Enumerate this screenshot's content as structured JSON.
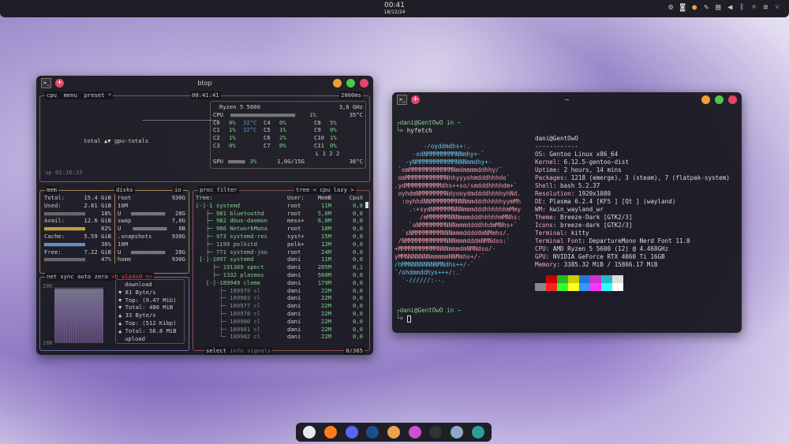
{
  "topbar": {
    "time": "00:41",
    "date": "18/12/24",
    "tray_icons": [
      "network-icon",
      "discord-icon",
      "avatar-icon",
      "color-picker-icon",
      "clipboard-icon",
      "volume-icon",
      "bluetooth-icon",
      "brightness-icon",
      "wifi-icon",
      "chevron-down-icon"
    ]
  },
  "btop": {
    "title": "btop",
    "cpu": {
      "tabs": [
        "cpu",
        "menu",
        "preset *"
      ],
      "clock": "00:41:41",
      "interval": "2000ms",
      "model": "Ryzen 5 5600",
      "freq": "3,6 GHz",
      "total": {
        "label": "CPU",
        "pct": "1%",
        "temp": "35°C"
      },
      "cores": [
        [
          "C0",
          "0%",
          "32°C"
        ],
        [
          "C1",
          "1%",
          "32°C"
        ],
        [
          "C2",
          "1%",
          ""
        ],
        [
          "C3",
          "0%",
          ""
        ],
        [
          "C4",
          "0%",
          ""
        ],
        [
          "C5",
          "1%",
          ""
        ],
        [
          "C6",
          "2%",
          ""
        ],
        [
          "C7",
          "0%",
          ""
        ],
        [
          "C8",
          "5%",
          ""
        ],
        [
          "C9",
          "0%",
          ""
        ],
        [
          "C10",
          "1%",
          ""
        ],
        [
          "C11",
          "0%",
          ""
        ]
      ],
      "load": "L 1 2 2",
      "gpu": {
        "label": "GPU",
        "pct": "3%",
        "mem": "1,0G/15G",
        "temp": "36°C"
      },
      "graph_label": "total ▲▼ gpu-totals",
      "uptime": "up 02:16:15"
    },
    "mem": {
      "header": "mem",
      "rows": [
        [
          "Total:",
          "15.4 GiB",
          ""
        ],
        [
          "Used:",
          "2.81 GiB",
          "18%"
        ],
        [
          "Avail:",
          "12.6 GiB",
          "82%"
        ],
        [
          "Cache:",
          "5.59 GiB",
          "36%"
        ],
        [
          "Free:",
          "7.22 GiB",
          "47%"
        ]
      ]
    },
    "disks": {
      "header": "disks",
      "io": "io",
      "items": [
        [
          "root",
          "930G",
          "10M",
          "U",
          "28G"
        ],
        [
          "swap",
          "7,0G",
          "",
          "U",
          "0B"
        ],
        [
          ".snapshots",
          "930G",
          "10M",
          "U",
          "28G"
        ],
        [
          "home",
          "930G",
          "",
          "",
          ""
        ]
      ]
    },
    "net": {
      "header": "net",
      "tabs": [
        "sync",
        "auto",
        "zero",
        "<b wlp4s0 n>"
      ],
      "scale_top": "20K",
      "scale_bottom": "20K",
      "lines": [
        "download",
        "▼ 81 Byte/s",
        "▼ Top: (9.47 Mib)",
        "▼ Total:  480 MiB",
        "▲ 33 Byte/s",
        "▲ Top: (512 Kibp)",
        "▲ Total: 58.8 MiB",
        "upload"
      ]
    },
    "proc": {
      "header": "proc",
      "filter": "filter",
      "tree": "tree",
      "sort": "< cpu lazy >",
      "columns": [
        "Tree:",
        "User:",
        "MemB",
        "CpuX"
      ],
      "rows": [
        [
          "[-]-1 systemd",
          "root",
          "11M",
          "0,0"
        ],
        [
          "   ├─ 981 bluetoothd",
          "root",
          "5,0M",
          "0,0"
        ],
        [
          "   ├─ 982 dbus-daemon",
          "mess+",
          "6,0M",
          "0,0"
        ],
        [
          "   ├─ 986 NetworkMana",
          "root",
          "10M",
          "0,0"
        ],
        [
          "   ├─ 973 systemd-res",
          "syst+",
          "15M",
          "0,0"
        ],
        [
          "   ├─ 1199 polkitd",
          "polk+",
          "12M",
          "0,0"
        ],
        [
          "   ├─ 771 systemd-jou",
          "root",
          "24M",
          "0,0"
        ],
        [
          " [-]-1097 systemd",
          "dani",
          "11M",
          "0,0"
        ],
        [
          "     ├─ 191389 spect",
          "dani",
          "205M",
          "0,1"
        ],
        [
          "     ├─ 1332 plasmas",
          "dani",
          "560M",
          "0,0"
        ],
        [
          "   [-]-189949 cleme",
          "dani",
          "179M",
          "0,0"
        ],
        [
          "       ├─ 189979 cl",
          "dani",
          "22M",
          "0,0"
        ],
        [
          "       ├─ 189983 cl",
          "dani",
          "22M",
          "0,0"
        ],
        [
          "       ├─ 189977 cl",
          "dani",
          "22M",
          "0,0"
        ],
        [
          "       ├─ 189978 cl",
          "dani",
          "22M",
          "0,0"
        ],
        [
          "       ├─ 189980 cl",
          "dani",
          "22M",
          "0,0"
        ],
        [
          "       ├─ 189981 cl",
          "dani",
          "22M",
          "0,0"
        ],
        [
          "       └─ 189982 cl",
          "dani",
          "22M",
          "0,0"
        ]
      ],
      "footer": [
        "select",
        "info",
        "signals"
      ],
      "count": "0/365"
    }
  },
  "kitty": {
    "title": "~",
    "prompt1": "dani@GentOwO in ~",
    "command": "hyfetch",
    "art": [
      "        -/oyddmdhs+:.",
      "     -odNMMMMMMMMNNmhy+-`",
      "   -yNMMMMMMMMMMMNNNmmdhy+-",
      " `omMMMMMMMMMMMMNmdmmmmddhhy/`",
      " omMMMMMMMMMMMNhhyyyohmdddhhhdo`",
      ".ydMMMMMMMMMMdhs++so/smdddhhhhdm+`",
      " oyhdmNMMMMMMMNdyooydmddddhhhhyhNd.",
      "  :oyhhdNNMMMMMMMNNNmmdddhhhhhyymMh",
      "    .:+sydNMMMMMNNNmmmdddhhhhhhmMmy",
      "       /mMMMMMMNNNmmmdddhhhhhmMNhs:",
      "    `oNMMMMMMMNNNmmmddddhhdmMNhs+`",
      "  `sNMMMMMMMMNNNmmmdddddmNMmhs/.",
      " /NMMMMMMMMMMMNNNmmmdddmNMNdso:`",
      "+MMMMMMMMMMMNNNmmmdmNMNdso/-",
      "yMMNNNNNNNmmmmmNNMmhs+/-`",
      "/hMMNNNNNNNNMNdhs++/-`",
      "`/ohdmmddhys+++/:.`",
      "  `-//////:--."
    ],
    "user": "dani@GentOwO",
    "sep": "------------",
    "info": [
      [
        "OS",
        "Gentoo Linux x86_64"
      ],
      [
        "Kernel",
        "6.12.5-gentoo-dist"
      ],
      [
        "Uptime",
        "2 hours, 14 mins"
      ],
      [
        "Packages",
        "1218 (emerge), 3 (steam), 7 (flatpak-system)"
      ],
      [
        "Shell",
        "bash 5.2.37"
      ],
      [
        "Resolution",
        "1920x1080"
      ],
      [
        "DE",
        "Plasma 6.2.4 [KF5 ] [Qt ] (wayland)"
      ],
      [
        "WM",
        "kwin_wayland_wr"
      ],
      [
        "Theme",
        "Breeze-Dark [GTK2/3]"
      ],
      [
        "Icons",
        "breeze-dark [GTK2/3]"
      ],
      [
        "Terminal",
        "kitty"
      ],
      [
        "Terminal Font",
        "DepartureMono Nerd Font 11.0"
      ],
      [
        "CPU",
        "AMD Ryzen 5 5600 (12) @ 4.468GHz"
      ],
      [
        "GPU",
        "NVIDIA GeForce RTX 4060 Ti 16GB"
      ],
      [
        "Memory",
        "3385.32 MiB / 15866.17 MiB"
      ]
    ],
    "palette_top": [
      "#1e1e26",
      "#cc0000",
      "#22bb22",
      "#cccc00",
      "#2277dd",
      "#cc33cc",
      "#22bbcc",
      "#dddddd"
    ],
    "palette_bottom": [
      "#888888",
      "#ff2222",
      "#33ff33",
      "#ffff22",
      "#3399ff",
      "#ff33ff",
      "#33ffff",
      "#ffffff"
    ],
    "prompt2": "dani@GentOwO in ~"
  },
  "dock": {
    "apps": [
      {
        "name": "dolphin",
        "color": "#e8e8f0"
      },
      {
        "name": "firefox",
        "color": "#ff7b1c"
      },
      {
        "name": "discord",
        "color": "#5865f2"
      },
      {
        "name": "steam",
        "color": "#1b4f8a"
      },
      {
        "name": "tweaks",
        "color": "#f0a050"
      },
      {
        "name": "color-app",
        "color": "#d04fd0"
      },
      {
        "name": "kitty",
        "color": "#333"
      },
      {
        "name": "files",
        "color": "#8fa8c8"
      },
      {
        "name": "monitor",
        "color": "#2aa198"
      }
    ]
  }
}
